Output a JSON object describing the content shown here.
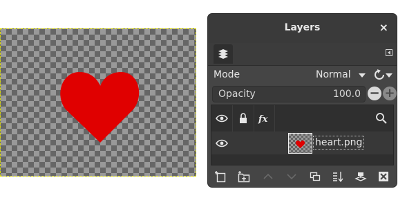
{
  "canvas": {
    "image": "heart-icon"
  },
  "dock": {
    "title": "Layers",
    "close_label": "×",
    "mode_label": "Mode",
    "mode_value": "Normal",
    "opacity_label": "Opacity",
    "opacity_value": "100.0",
    "opacity_minus": "−",
    "opacity_plus": "+",
    "columns": [
      "eye-icon",
      "lock-icon",
      "fx-icon",
      "search-icon"
    ],
    "fx_label": "fx",
    "layers": [
      {
        "name": "heart.png",
        "visible": true
      }
    ],
    "bottom_buttons": [
      "new-layer-icon",
      "new-layer-group-icon",
      "raise-layer-icon",
      "lower-layer-icon",
      "duplicate-layer-icon",
      "merge-down-icon",
      "anchor-layer-icon",
      "delete-layer-icon"
    ]
  },
  "colors": {
    "heart": "#e00000",
    "dock_bg": "#454545",
    "selection": "#d8d800"
  }
}
